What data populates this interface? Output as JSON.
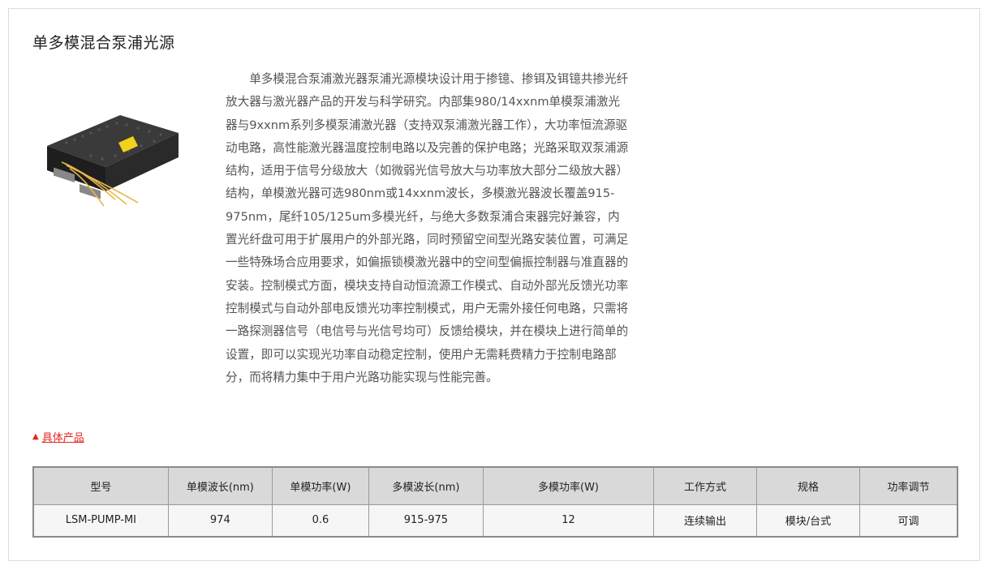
{
  "page_title": "单多模混合泵浦光源",
  "product_image": {
    "alt": "单多模混合泵浦光源模块",
    "icon": "laser-module-image"
  },
  "description": "单多模混合泵浦激光器泵浦光源模块设计用于掺镱、掺铒及铒镱共掺光纤放大器与激光器产品的开发与科学研究。内部集980/14xxnm单模泵浦激光器与9xxnm系列多模泵浦激光器（支持双泵浦激光器工作），大功率恒流源驱动电路，高性能激光器温度控制电路以及完善的保护电路；光路采取双泵浦源结构，适用于信号分级放大（如微弱光信号放大与功率放大部分二级放大器）结构，单模激光器可选980nm或14xxnm波长，多模激光器波长覆盖915-975nm，尾纤105/125um多模光纤，与绝大多数泵浦合束器完好兼容，内置光纤盘可用于扩展用户的外部光路，同时预留空间型光路安装位置，可满足一些特殊场合应用要求，如偏振锁模激光器中的空间型偏振控制器与准直器的安装。控制模式方面，模块支持自动恒流源工作模式、自动外部光反馈光功率控制模式与自动外部电反馈光功率控制模式，用户无需外接任何电路，只需将一路探测器信号（电信号与光信号均可）反馈给模块，并在模块上进行简单的设置，即可以实现光功率自动稳定控制，使用户无需耗费精力于控制电路部分，而将精力集中于用户光路功能实现与性能完善。",
  "section_link": {
    "icon": "triangle-up-icon",
    "label": "具体产品",
    "color": "#e8231d"
  },
  "table": {
    "headers": [
      "型号",
      "单模波长(nm)",
      "单模功率(W)",
      "多模波长(nm)",
      "多模功率(W)",
      "工作方式",
      "规格",
      "功率调节"
    ],
    "rows": [
      [
        "LSM-PUMP-MI",
        "974",
        "0.6",
        "915-975",
        "12",
        "连续输出",
        "模块/台式",
        "可调"
      ]
    ]
  }
}
